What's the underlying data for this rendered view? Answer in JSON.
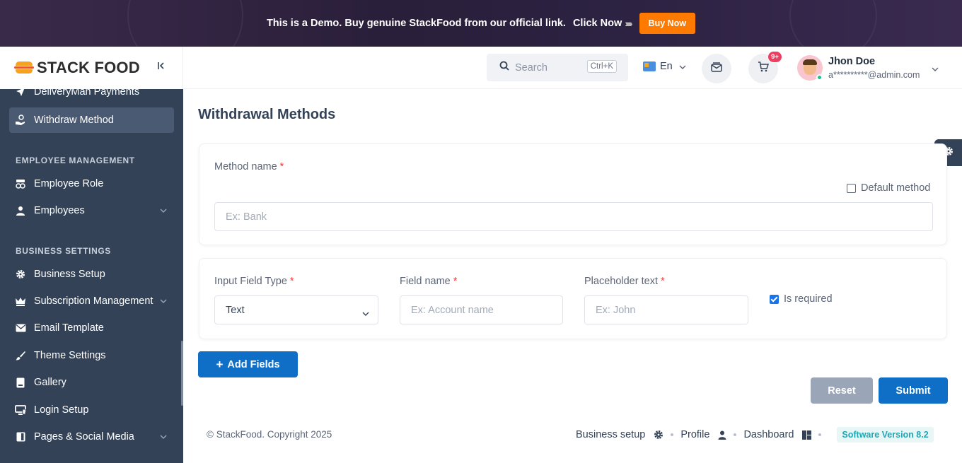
{
  "banner": {
    "text": "This is a Demo. Buy genuine StackFood from our official link.",
    "click_text": "Click Now",
    "arrows": "›››››",
    "buy_label": "Buy Now"
  },
  "brand": {
    "logo_text": "STACK FOOD",
    "collapse_icon": "collapse-left-icon"
  },
  "sidebar": {
    "items_top": [
      {
        "label": "DeliveryMan Payments",
        "icon": "send-icon"
      },
      {
        "label": "Withdraw Method",
        "icon": "hand-coin-icon",
        "active": true
      }
    ],
    "employee_heading": "EMPLOYEE MANAGEMENT",
    "employee_items": [
      {
        "label": "Employee Role",
        "icon": "user-role-icon"
      },
      {
        "label": "Employees",
        "icon": "user-icon",
        "has_submenu": true
      }
    ],
    "business_heading": "BUSINESS SETTINGS",
    "business_items": [
      {
        "label": "Business Setup",
        "icon": "gear-icon"
      },
      {
        "label": "Subscription Management",
        "icon": "crown-icon",
        "has_submenu": true
      },
      {
        "label": "Email Template",
        "icon": "envelope-icon"
      },
      {
        "label": "Theme Settings",
        "icon": "brush-icon"
      },
      {
        "label": "Gallery",
        "icon": "gallery-icon"
      },
      {
        "label": "Login Setup",
        "icon": "monitor-icon"
      },
      {
        "label": "Pages & Social Media",
        "icon": "pages-icon",
        "has_submenu": true
      }
    ]
  },
  "header": {
    "search_placeholder": "Search",
    "search_shortcut": "Ctrl+K",
    "language": "En",
    "cart_badge": "9+",
    "user_name": "Jhon Doe",
    "user_email": "a**********@admin.com"
  },
  "main": {
    "title": "Withdrawal Methods",
    "method_name_label": "Method name",
    "required_mark": "*",
    "default_method_label": "Default method",
    "default_method_checked": false,
    "method_name_placeholder": "Ex: Bank",
    "input_field_type_label": "Input Field Type",
    "input_field_type_value": "Text",
    "field_name_label": "Field name",
    "field_name_placeholder": "Ex: Account name",
    "placeholder_text_label": "Placeholder text",
    "placeholder_text_placeholder": "Ex: John",
    "is_required_label": "Is required",
    "is_required_checked": true,
    "add_fields_label": "Add Fields",
    "reset_label": "Reset",
    "submit_label": "Submit"
  },
  "footer": {
    "copyright": "© StackFood. Copyright 2025",
    "links": [
      {
        "label": "Business setup",
        "icon": "gear-icon"
      },
      {
        "label": "Profile",
        "icon": "user-icon"
      },
      {
        "label": "Dashboard",
        "icon": "dashboard-icon"
      }
    ],
    "version": "Software Version 8.2"
  },
  "colors": {
    "sidebar_bg": "#334257",
    "primary": "#0f6fc6",
    "buy_button": "#ff7a00",
    "reset_button": "#9aa6b8",
    "badge": "#ee3d61"
  }
}
